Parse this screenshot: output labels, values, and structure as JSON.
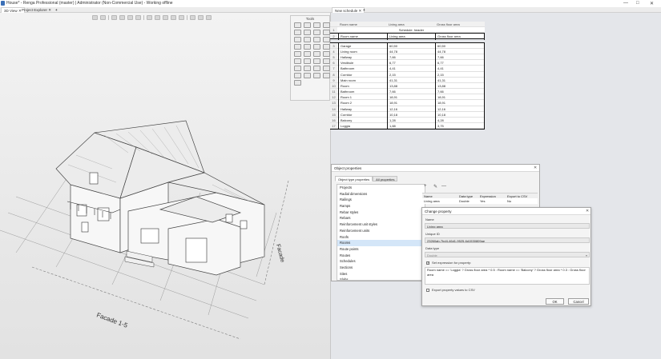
{
  "window": {
    "title": "House* - Renga Professional (master) | Administrator (Non-Commercial Use) - Working offline",
    "minimize": "—",
    "maximize": "□",
    "close": "✕"
  },
  "left_tabs": [
    {
      "label": "3D View"
    },
    {
      "label": "Project Explorer"
    }
  ],
  "right_tabs": [
    {
      "label": "New schedule"
    }
  ],
  "tools_panel": {
    "title": "Tools"
  },
  "viewport_labels": {
    "facade": "Facade 1-5",
    "axis_label": "Facade"
  },
  "schedule": {
    "columns": [
      "Room name",
      "Living area",
      "Gross floor area"
    ],
    "header_row": {
      "n": "1",
      "text": "Schedule: header"
    },
    "title_row": {
      "n": "2",
      "c1": "Room name",
      "c2": "Living area",
      "c3": "Gross floor area"
    },
    "rows": [
      {
        "n": "3",
        "c1": "Garage",
        "c2": "60,50",
        "c3": "60,50"
      },
      {
        "n": "4",
        "c1": "Living room",
        "c2": "44,78",
        "c3": "44,78"
      },
      {
        "n": "5",
        "c1": "Hallway",
        "c2": "7,66",
        "c3": "7,66"
      },
      {
        "n": "6",
        "c1": "Vestibule",
        "c2": "6,77",
        "c3": "6,77"
      },
      {
        "n": "7",
        "c1": "Bathroom",
        "c2": "4,41",
        "c3": "4,41"
      },
      {
        "n": "8",
        "c1": "Corridor",
        "c2": "2,15",
        "c3": "2,15"
      },
      {
        "n": "9",
        "c1": "Main room",
        "c2": "41,31",
        "c3": "41,31"
      },
      {
        "n": "10",
        "c1": "Room",
        "c2": "13,88",
        "c3": "13,88"
      },
      {
        "n": "11",
        "c1": "Bathroom",
        "c2": "7,66",
        "c3": "7,66"
      },
      {
        "n": "12",
        "c1": "Room 1",
        "c2": "18,91",
        "c3": "18,91"
      },
      {
        "n": "13",
        "c1": "Room 2",
        "c2": "18,91",
        "c3": "18,91"
      },
      {
        "n": "14",
        "c1": "Hallway",
        "c2": "12,16",
        "c3": "12,16"
      },
      {
        "n": "15",
        "c1": "Corridor",
        "c2": "10,18",
        "c3": "10,18"
      },
      {
        "n": "16",
        "c1": "Balcony",
        "c2": "1,28",
        "c3": "4,28"
      },
      {
        "n": "17",
        "c1": "Loggia",
        "c2": "1,88",
        "c3": "3,75"
      }
    ]
  },
  "object_properties": {
    "title": "Object properties",
    "tabs": [
      "Object type properties",
      "All properties"
    ],
    "types": [
      "Projects",
      "Radial dimensions",
      "Railings",
      "Ramps",
      "Rebar styles",
      "Rebars",
      "Reinforcement unit styles",
      "Reinforcement units",
      "Roofs",
      "Rooms",
      "Route points",
      "Routes",
      "Schedules",
      "Sections",
      "Sites",
      "Slabs"
    ],
    "selected_type": "Rooms",
    "toolbar": {
      "add": "+",
      "edit": "✎",
      "remove": "—"
    },
    "table_headers": [
      "Name",
      "Data type",
      "Expression",
      "Export to CSV"
    ],
    "table_row": {
      "name": "Living area",
      "type": "Double",
      "expression": "Yes",
      "export": "No"
    }
  },
  "change_property": {
    "title": "Change property",
    "name_label": "Name",
    "name_value": "Living area",
    "uid_label": "Unique ID",
    "uid_value": "23260ab-7bd4-46d1-9525-6d1530809ae",
    "data_type_label": "Data type",
    "data_type_value": "Double",
    "set_expression_label": "Set expression for property:",
    "expression": "Room name == 'Loggia' ? Gross floor area * 0.5 : Room name == 'Balcony' ? Gross floor area * 0.3 : Gross floor area",
    "export_csv_label": "Export property values to CSV",
    "ok": "OK",
    "cancel": "Cancel"
  },
  "colors": {
    "selection": "#d4e6f8",
    "dialog_bg": "#f2f2f2",
    "right_bg": "#e4e6ea"
  }
}
